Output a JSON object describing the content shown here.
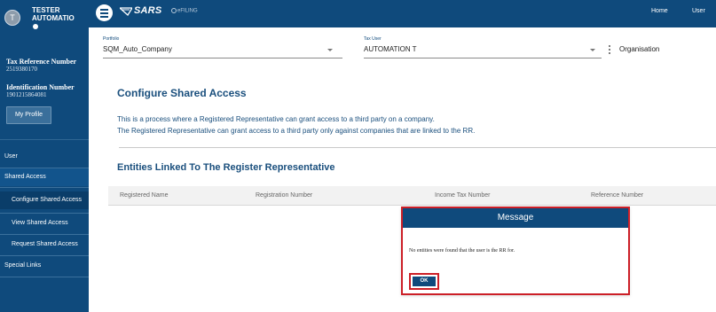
{
  "colors": {
    "primary": "#0f4a7c",
    "heading": "#1a4f7d",
    "highlight": "#cc1f27"
  },
  "sidebar": {
    "avatar_initial": "T",
    "user_name_line1": "TESTER",
    "user_name_line2": "AUTOMATIO",
    "tax_ref_label": "Tax Reference Number",
    "tax_ref_value": "2519380170",
    "id_label": "Identification Number",
    "id_value": "1901215864081",
    "profile_button": "My Profile",
    "nav": {
      "user": "User",
      "shared_access": "Shared Access",
      "configure": "Configure Shared Access",
      "view": "View Shared Access",
      "request": "Request Shared Access",
      "special_links": "Special Links"
    }
  },
  "topbar": {
    "menu_icon": "hamburger-menu-icon",
    "logo_text": "SARS",
    "logo_sub": "eFILING",
    "home": "Home",
    "user": "User"
  },
  "selectors": {
    "portfolio_label": "Portfolio",
    "portfolio_value": "SQM_Auto_Company",
    "tax_user_label": "Tax User",
    "tax_user_value": "AUTOMATION T",
    "organisation": "Organisation"
  },
  "main": {
    "title": "Configure Shared Access",
    "description_line1": "This is a process where a Registered Representative can grant access to a third party on a company.",
    "description_line2": "The Registered Representative can grant access to a third party only against companies that are linked to the RR.",
    "entities_title": "Entities Linked To The Register Representative",
    "columns": [
      "Registered Name",
      "Registration Number",
      "Income Tax Number",
      "Reference Number"
    ]
  },
  "modal": {
    "title": "Message",
    "body": "No entities were found that the user is the RR for.",
    "ok": "OK"
  }
}
